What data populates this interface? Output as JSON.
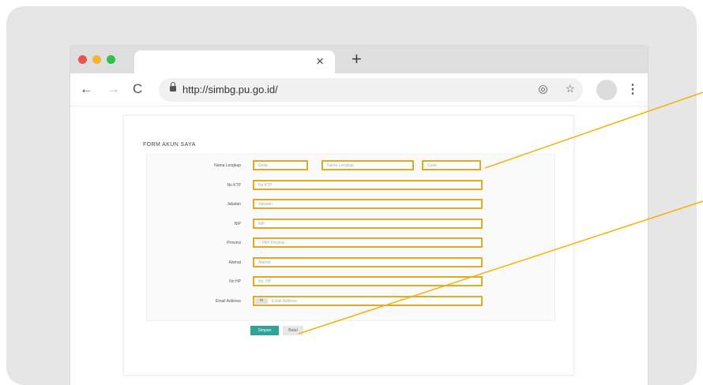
{
  "browser": {
    "tab": {
      "title": "",
      "close_glyph": "×"
    },
    "new_tab_glyph": "+",
    "nav": {
      "back_glyph": "←",
      "forward_glyph": "→",
      "reload_glyph": "C"
    },
    "url": "http://simbg.pu.go.id/",
    "icons": {
      "location": "location-target-icon",
      "star": "star-icon",
      "menu": "kebab-menu-icon"
    },
    "omni_location_glyph": "◎",
    "omni_star_glyph": "☆",
    "menu_glyph": "⋮"
  },
  "form": {
    "title": "FORM AKUN SAYA",
    "rows": [
      {
        "label": "Nama Lengkap",
        "placeholders": [
          "Gelar",
          "Nama Lengkap",
          "Gelar"
        ]
      },
      {
        "label": "No KTP",
        "placeholder": "No KTP"
      },
      {
        "label": "Jabatan",
        "placeholder": "Jabatan"
      },
      {
        "label": "NIP",
        "placeholder": "NIP"
      },
      {
        "label": "Provinsi",
        "placeholder": "-- Pilih Provinsi --"
      },
      {
        "label": "Alamat",
        "placeholder": "Alamat"
      },
      {
        "label": "No HP",
        "placeholder": "No. HP"
      },
      {
        "label": "Email Address",
        "addon": "✉",
        "placeholder": "Email Address"
      }
    ],
    "buttons": {
      "save": "Simpan",
      "back": "Batal"
    }
  },
  "colors": {
    "highlight": "#e3a91f",
    "callout_line": "#f2b411",
    "save_button": "#2ea39a"
  }
}
